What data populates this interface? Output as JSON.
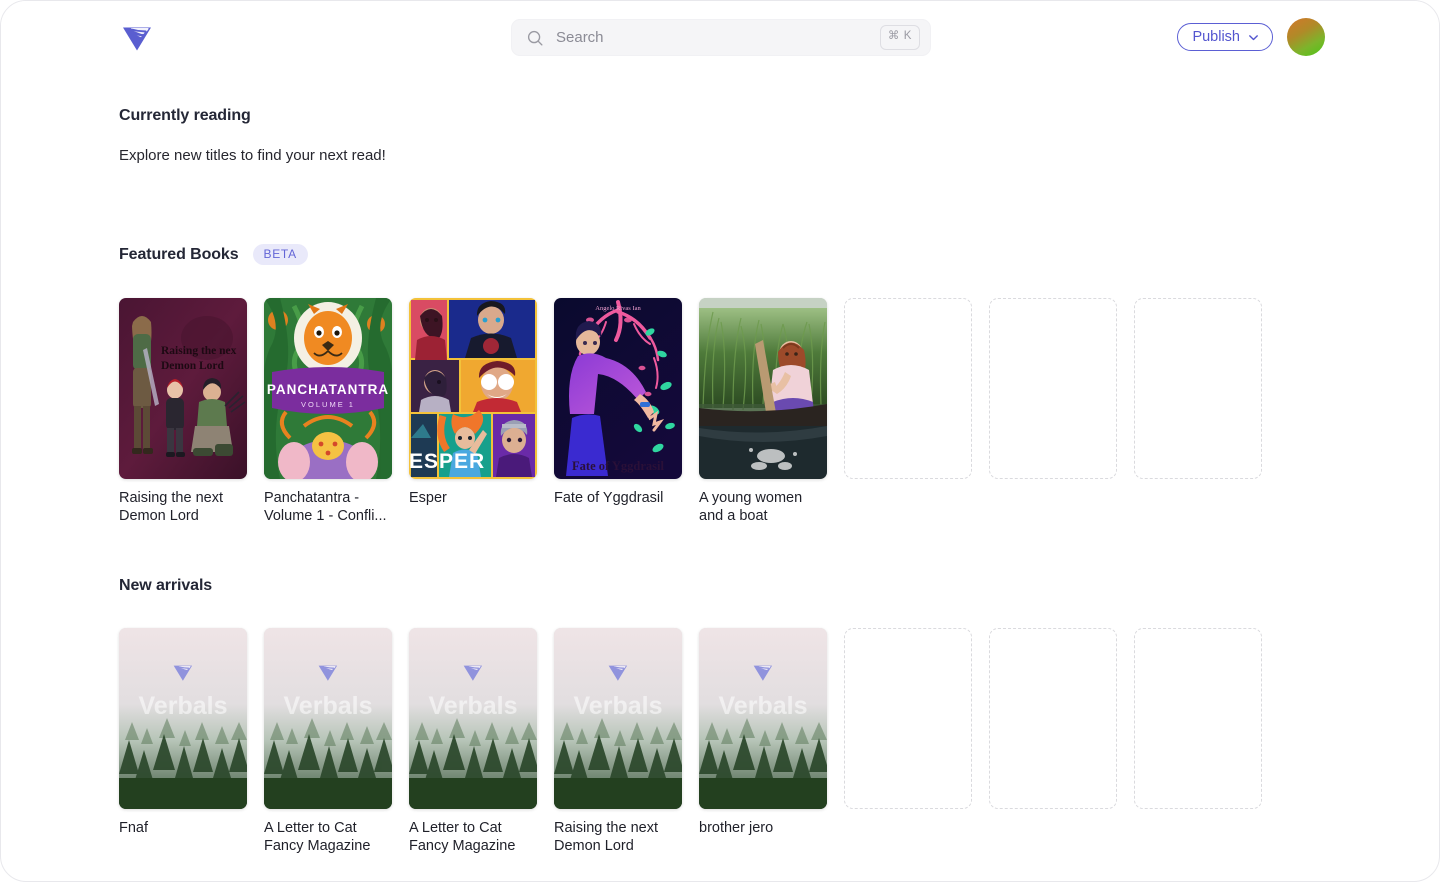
{
  "header": {
    "logo_name": "verbals-logo",
    "search": {
      "placeholder": "Search",
      "value": "",
      "shortcut": "⌘ K",
      "icon": "search-icon"
    },
    "publish_label": "Publish",
    "publish_icon": "chevron-down-icon",
    "avatar_name": "user-avatar"
  },
  "colors": {
    "accent": "#5355cf",
    "badge_bg": "#e9e9fa",
    "badge_text": "#6365d6",
    "heading": "#242736",
    "search_bg": "#f5f5f7",
    "placeholder_border": "#dadade"
  },
  "currently_reading": {
    "title": "Currently reading",
    "subtitle": "Explore new titles to find your next read!"
  },
  "featured": {
    "title": "Featured Books",
    "badge": "BETA",
    "books": [
      {
        "title": "Raising the next Demon Lord",
        "cover": "demon-lord"
      },
      {
        "title": "Panchatantra - Volume 1 - Confli...",
        "cover": "panchatantra"
      },
      {
        "title": "Esper",
        "cover": "esper"
      },
      {
        "title": "Fate of Yggdrasil",
        "cover": "yggdrasil"
      },
      {
        "title": "A young women and a boat",
        "cover": "boat-photo"
      }
    ],
    "empty_slots": 3
  },
  "new_arrivals": {
    "title": "New arrivals",
    "books": [
      {
        "title": "Fnaf",
        "cover": "verbals-placeholder"
      },
      {
        "title": "A Letter to Cat Fancy Magazine",
        "cover": "verbals-placeholder"
      },
      {
        "title": "A Letter to Cat Fancy Magazine",
        "cover": "verbals-placeholder"
      },
      {
        "title": "Raising the next Demon Lord",
        "cover": "verbals-placeholder"
      },
      {
        "title": "brother jero",
        "cover": "verbals-placeholder"
      }
    ],
    "empty_slots": 3,
    "placeholder_wordmark": "Verbals"
  }
}
